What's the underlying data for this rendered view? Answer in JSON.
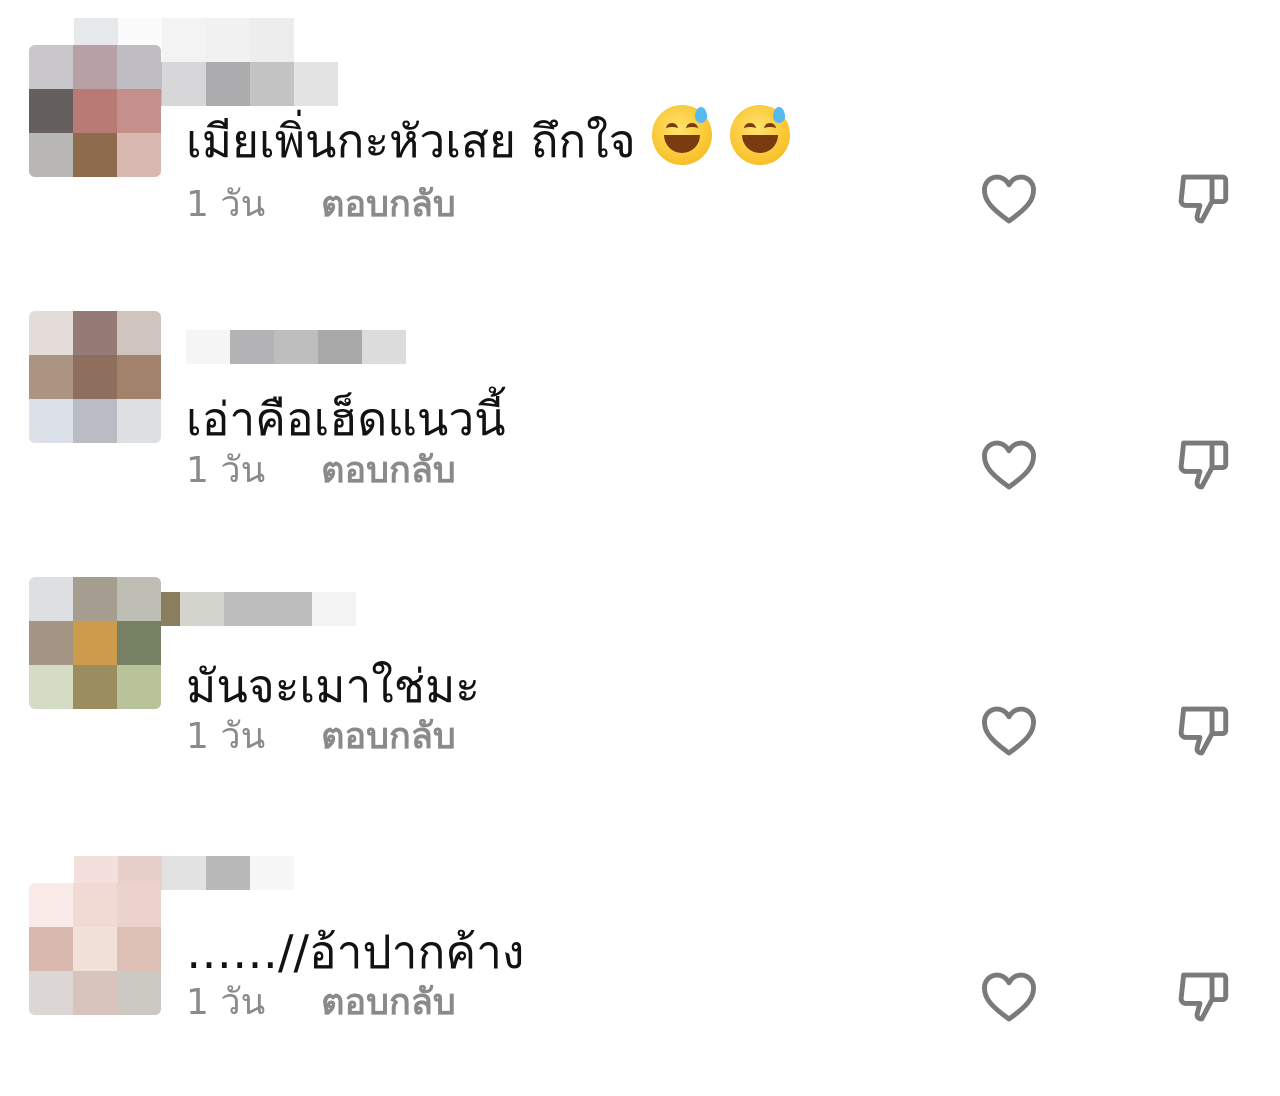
{
  "comments": [
    {
      "avatar_colors": [
        "#c9c7c9",
        "#b8a1a4",
        "#bfbdc3",
        "#65605f",
        "#b97a75",
        "#c58f8b",
        "#b9b7b6",
        "#8f6b4d",
        "#d8b8b1"
      ],
      "name_colors": [
        "#e6e9ec",
        "#fbfbfb",
        "#f3f3f3",
        "#f1f1f1",
        "#ededed",
        "#ffffff",
        "#b5a0a4",
        "#bdbcc1",
        "#d7d6d8",
        "#acabad",
        "#c3c3c4",
        "#e3e3e3"
      ],
      "text": "เมียเพิ่นกะหัวเสย ถึกใจ",
      "emojis": [
        "grinning-sweat-emoji",
        "grinning-sweat-emoji"
      ],
      "time": "1 วัน",
      "reply": "ตอบกลับ"
    },
    {
      "avatar_colors": [
        "#e4dcd8",
        "#957b76",
        "#cfc4be",
        "#ab9582",
        "#8e6f5d",
        "#a2826a",
        "#dde2ea",
        "#b9bcc2",
        "#dde0e2"
      ],
      "name_colors": [
        "#ffffff",
        "#f5f5f5",
        "#b3b3b6",
        "#bebebe",
        "#a9a9a9",
        "#dcdcdc"
      ],
      "text": "เอ่าคือเฮ็ดแนวนี้",
      "time": "1 วัน",
      "reply": "ตอบกลับ"
    },
    {
      "avatar_colors": [
        "#dddfe1",
        "#a59d90",
        "#bdbdb4",
        "#a49584",
        "#cc9b4c",
        "#768164",
        "#d5dcc6",
        "#9b8d5d",
        "#b9c39a"
      ],
      "name_colors": [
        "#f8f3f2",
        "#8b7e5e",
        "#d3d4cc",
        "#bdbdbd",
        "#bdbdbd",
        "#f3f3f3"
      ],
      "text": "มันจะเมาใช่มะ",
      "time": "1 วัน",
      "reply": "ตอบกลับ"
    },
    {
      "avatar_colors": [
        "#f8ebe8",
        "#f1dad4",
        "#ecd2cd",
        "#d9b8ad",
        "#f1e1d8",
        "#dcc0b6",
        "#dcd6d4",
        "#d8c4bd",
        "#ccc8c2"
      ],
      "name_colors": [
        "#ffffff",
        "#f3e0dc",
        "#e7d0c9",
        "#e2e2e2",
        "#b9b9b9",
        "#f7f7f7"
      ],
      "text": "……//อ้าปากค้าง",
      "time": "1 วัน",
      "reply": "ตอบกลับ"
    }
  ]
}
